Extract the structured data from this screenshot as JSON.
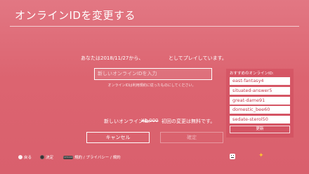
{
  "header": {
    "title": "オンラインIDを変更する"
  },
  "since": {
    "prefix": "あなたは2018/11/27から、",
    "suffix": "としてプレイしています。"
  },
  "id_input": {
    "placeholder": "新しいオンラインIDを入力",
    "hint": "オンラインIDは利用規約に従ったものにしてください。"
  },
  "suggestions": {
    "title": "おすすめのオンラインID:",
    "items": [
      "east-fantasy4",
      "situated-answer5",
      "great-dame91",
      "domestic_bee60",
      "sedate-sterol50"
    ],
    "refresh_label": "更新"
  },
  "price": {
    "label": "新しいオンラインID:",
    "old_price": "¥1,000",
    "note": "初回の変更は無料です。"
  },
  "buttons": {
    "cancel": "キャンセル",
    "ok": "確定"
  },
  "footer": {
    "back": "戻る",
    "confirm": "決定",
    "options_key": "OPTIONS",
    "terms": "規約 / プライバシー / 規約"
  },
  "colors": {
    "background": "#dc6470",
    "accent_text": "#c43a4c",
    "star": "#ffc430"
  },
  "icons": [
    "circle-button-icon",
    "cross-button-icon",
    "options-button-icon",
    "emoji-icon",
    "star-icon"
  ]
}
